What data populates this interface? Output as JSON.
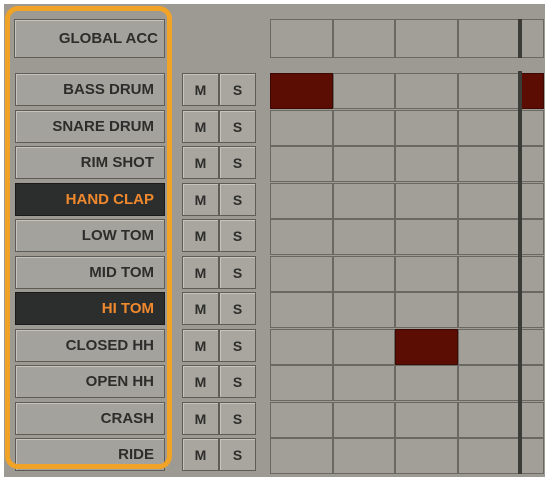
{
  "global_acc": {
    "label": "GLOBAL ACC"
  },
  "mute_label": "M",
  "solo_label": "S",
  "colors": {
    "panel": "#9c9a93",
    "active_step": "#5b0d03",
    "selected_track_bg": "#2c2e2d",
    "selected_track_text": "#f0892e",
    "highlight_frame": "#f0a326"
  },
  "tracks": [
    {
      "name": "BASS DRUM",
      "selected": false,
      "steps": [
        1,
        0,
        0,
        0,
        1
      ]
    },
    {
      "name": "SNARE DRUM",
      "selected": false,
      "steps": [
        0,
        0,
        0,
        0,
        0
      ]
    },
    {
      "name": "RIM SHOT",
      "selected": false,
      "steps": [
        0,
        0,
        0,
        0,
        0
      ]
    },
    {
      "name": "HAND CLAP",
      "selected": true,
      "steps": [
        0,
        0,
        0,
        0,
        0
      ]
    },
    {
      "name": "LOW TOM",
      "selected": false,
      "steps": [
        0,
        0,
        0,
        0,
        0
      ]
    },
    {
      "name": "MID TOM",
      "selected": false,
      "steps": [
        0,
        0,
        0,
        0,
        0
      ]
    },
    {
      "name": "HI TOM",
      "selected": true,
      "steps": [
        0,
        0,
        0,
        0,
        0
      ]
    },
    {
      "name": "CLOSED HH",
      "selected": false,
      "steps": [
        0,
        0,
        1,
        0,
        0
      ]
    },
    {
      "name": "OPEN HH",
      "selected": false,
      "steps": [
        0,
        0,
        0,
        0,
        0
      ]
    },
    {
      "name": "CRASH",
      "selected": false,
      "steps": [
        0,
        0,
        0,
        0,
        0
      ]
    },
    {
      "name": "RIDE",
      "selected": false,
      "steps": [
        0,
        0,
        0,
        0,
        0
      ]
    }
  ]
}
